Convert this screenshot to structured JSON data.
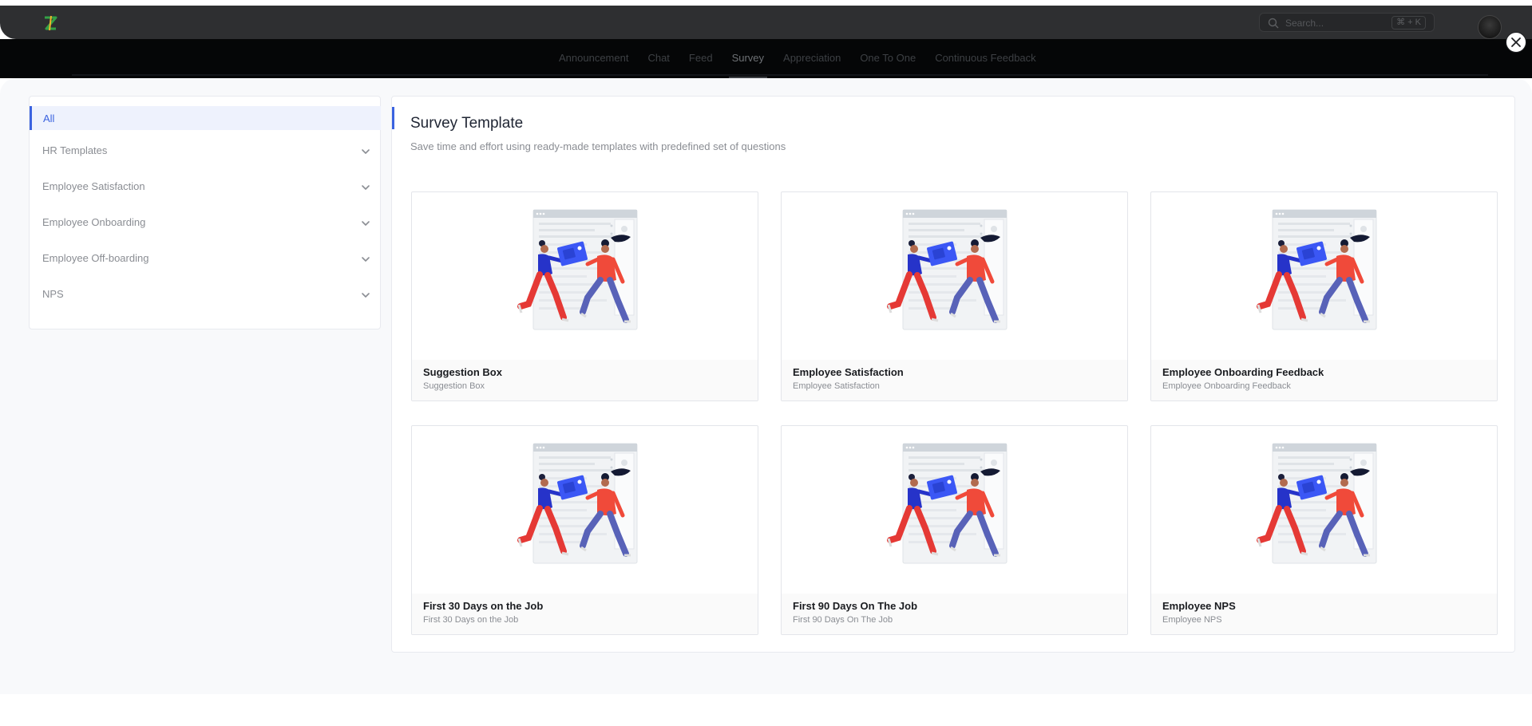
{
  "app": {
    "search_placeholder": "Search...",
    "search_shortcut": "⌘ + K",
    "nav_tabs": [
      "Announcement",
      "Chat",
      "Feed",
      "Survey",
      "Appreciation",
      "One To One",
      "Continuous Feedback"
    ],
    "active_tab": "Survey"
  },
  "sidebar": {
    "all_label": "All",
    "categories": [
      {
        "label": "HR Templates",
        "icon": "chevron-down-icon"
      },
      {
        "label": "Employee Satisfaction",
        "icon": "chevron-down-icon"
      },
      {
        "label": "Employee Onboarding",
        "icon": "chevron-down-icon"
      },
      {
        "label": "Employee Off-boarding",
        "icon": "chevron-down-icon"
      },
      {
        "label": "NPS",
        "icon": "chevron-down-icon"
      }
    ]
  },
  "main": {
    "title": "Survey Template",
    "subtitle": "Save time and effort using ready-made templates with predefined set of questions",
    "templates": [
      {
        "name": "Suggestion Box",
        "description": "Suggestion Box"
      },
      {
        "name": "Employee Satisfaction",
        "description": "Employee Satisfaction"
      },
      {
        "name": "Employee Onboarding Feedback",
        "description": "Employee Onboarding Feedback"
      },
      {
        "name": "First 30 Days on the Job",
        "description": "First 30 Days on the Job"
      },
      {
        "name": "First 90 Days On The Job",
        "description": "First 90 Days On The Job"
      },
      {
        "name": "Employee NPS",
        "description": "Employee NPS"
      }
    ]
  },
  "colors": {
    "accent": "#3b63e0",
    "selected_bg": "#eef2fd",
    "header_bg": "#2e2f31",
    "modal_bg": "#f8f9fb"
  }
}
